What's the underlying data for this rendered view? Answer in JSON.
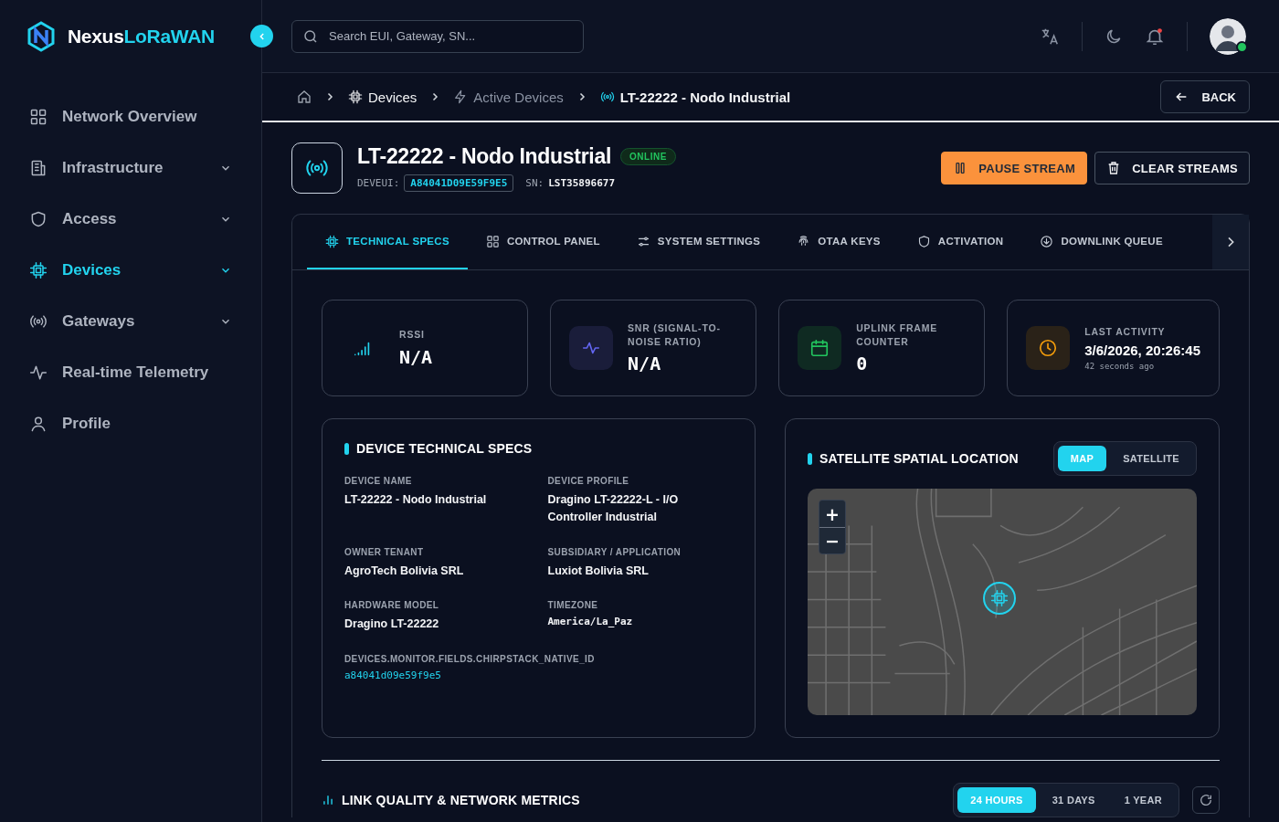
{
  "brand": {
    "name_part1": "Nexus",
    "name_part2": "LoRaWAN"
  },
  "sidebar": {
    "items": [
      {
        "label": "Network Overview",
        "selected": false,
        "has_submenu": false
      },
      {
        "label": "Infrastructure",
        "selected": false,
        "has_submenu": true
      },
      {
        "label": "Access",
        "selected": false,
        "has_submenu": true
      },
      {
        "label": "Devices",
        "selected": true,
        "has_submenu": true
      },
      {
        "label": "Gateways",
        "selected": false,
        "has_submenu": true
      },
      {
        "label": "Real-time Telemetry",
        "selected": false,
        "has_submenu": false
      },
      {
        "label": "Profile",
        "selected": false,
        "has_submenu": false
      }
    ]
  },
  "topbar": {
    "search": {
      "placeholder": "Search EUI, Gateway, SN..."
    },
    "notifications_unread": true,
    "user_online": true
  },
  "breadcrumb": [
    {
      "label": "Devices",
      "current": false
    },
    {
      "label": "Active Devices",
      "current": false
    },
    {
      "label": "LT-22222 - Nodo Industrial",
      "current": true
    }
  ],
  "back_button": "BACK",
  "device": {
    "title": "LT-22222 - Nodo Industrial",
    "status": "ONLINE",
    "online": true,
    "deveui_label": "DEVEUI:",
    "deveui": "A84041D09E59F9E5",
    "sn_label": "SN:",
    "sn": "LST35896677"
  },
  "actions": [
    "PAUSE STREAM",
    "CLEAR STREAMS"
  ],
  "tabs": [
    {
      "label": "TECHNICAL SPECS",
      "selected": true
    },
    {
      "label": "CONTROL PANEL",
      "selected": false
    },
    {
      "label": "SYSTEM SETTINGS",
      "selected": false
    },
    {
      "label": "OTAA KEYS",
      "selected": false
    },
    {
      "label": "ACTIVATION",
      "selected": false
    },
    {
      "label": "DOWNLINK QUEUE",
      "selected": false
    }
  ],
  "stats": [
    {
      "kind": "rssi",
      "label": "RSSI",
      "value": "N/A"
    },
    {
      "kind": "snr",
      "label": "SNR (SIGNAL-TO-NOISE RATIO)",
      "value": "N/A"
    },
    {
      "kind": "counter",
      "label": "UPLINK FRAME COUNTER",
      "value": "0"
    },
    {
      "kind": "activity",
      "label": "LAST ACTIVITY",
      "value": "3/6/2026, 20:26:45",
      "sub": "42 seconds ago"
    }
  ],
  "specs": {
    "title": "DEVICE TECHNICAL SPECS",
    "fields": [
      {
        "label": "DEVICE NAME",
        "value": "LT-22222 - Nodo Industrial",
        "mono": false
      },
      {
        "label": "DEVICE PROFILE",
        "value": "Dragino LT-22222-L - I/O Controller Industrial",
        "mono": false
      },
      {
        "label": "OWNER TENANT",
        "value": "AgroTech Bolivia SRL",
        "mono": false
      },
      {
        "label": "SUBSIDIARY / APPLICATION",
        "value": "Luxiot Bolivia SRL",
        "mono": false
      },
      {
        "label": "HARDWARE MODEL",
        "value": "Dragino LT-22222",
        "mono": false
      },
      {
        "label": "TIMEZONE",
        "value": "America/La_Paz",
        "mono": true
      }
    ],
    "native_id_label": "DEVICES.MONITOR.FIELDS.CHIRPSTACK_NATIVE_ID",
    "native_id": "a84041d09e59f9e5"
  },
  "location": {
    "title": "SATELLITE SPATIAL LOCATION",
    "modes": [
      {
        "label": "MAP",
        "selected": true
      },
      {
        "label": "SATELLITE",
        "selected": false
      }
    ],
    "zoom_in": "+",
    "zoom_out": "−"
  },
  "metrics": {
    "title": "LINK QUALITY & NETWORK METRICS",
    "ranges": [
      {
        "label": "24 HOURS",
        "selected": true
      },
      {
        "label": "31 DAYS",
        "selected": false
      },
      {
        "label": "1 YEAR",
        "selected": false
      }
    ]
  }
}
